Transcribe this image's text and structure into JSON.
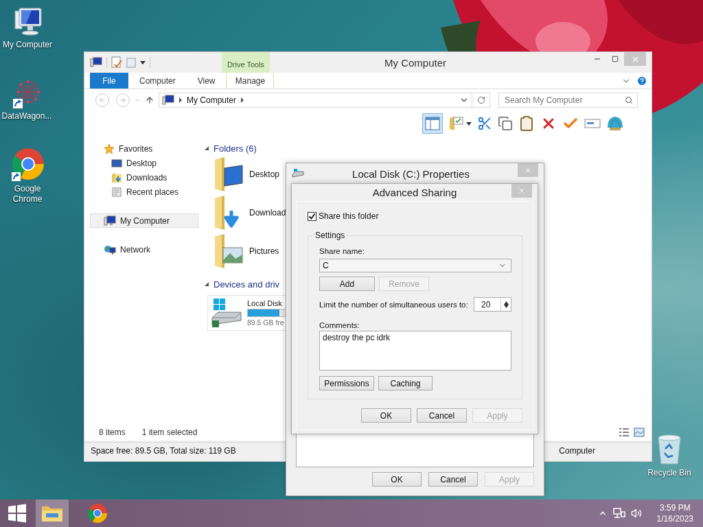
{
  "desktop_icons": [
    {
      "kind": "computer",
      "label": "My Computer"
    },
    {
      "kind": "shortcut",
      "label": "DataWagon..."
    },
    {
      "kind": "chrome",
      "label": "Google Chrome"
    },
    {
      "kind": "bin",
      "label": "Recycle Bin"
    }
  ],
  "explorer": {
    "title": "My Computer",
    "context_group": "Drive Tools",
    "ribbon_tabs": [
      {
        "kind": "file",
        "label": "File"
      },
      {
        "kind": "tab",
        "label": "Computer"
      },
      {
        "kind": "tab",
        "label": "View"
      },
      {
        "kind": "context",
        "label": "Manage"
      }
    ],
    "address": {
      "path": "My Computer"
    },
    "search": {
      "placeholder": "Search My Computer"
    },
    "preview_pane_on": true,
    "sidebar": [
      {
        "kind": "favorites",
        "label": "Favorites",
        "selected": false,
        "children": [
          {
            "kind": "desktop",
            "label": "Desktop",
            "selected": false
          },
          {
            "kind": "downloads",
            "label": "Downloads",
            "selected": false
          },
          {
            "kind": "recent",
            "label": "Recent places",
            "selected": false
          }
        ]
      },
      {
        "kind": "computer",
        "label": "My Computer",
        "selected": true
      },
      {
        "kind": "network",
        "label": "Network",
        "selected": false
      }
    ],
    "groups": [
      {
        "title": "Folders (6)",
        "expanded": true,
        "folders": [
          {
            "kind": "desktop",
            "label": "Desktop"
          },
          {
            "kind": "downloads",
            "label": "Download"
          },
          {
            "kind": "pictures",
            "label": "Pictures"
          }
        ]
      },
      {
        "title": "Devices and driv",
        "expanded": true,
        "drives": [
          {
            "label": "Local Disk",
            "level": 0.25,
            "free": "89.5 GB fre"
          }
        ]
      }
    ],
    "status": {
      "count": "8 items",
      "selection": "1 item selected"
    },
    "details": {
      "space": "Space free: 89.5 GB, Total size: 119 GB",
      "location": "Computer"
    }
  },
  "properties_dialog": {
    "title": "Local Disk (C:) Properties",
    "buttons": [
      {
        "label": "OK",
        "disabled": false
      },
      {
        "label": "Cancel",
        "disabled": false
      },
      {
        "label": "Apply",
        "disabled": true
      }
    ]
  },
  "advanced_sharing": {
    "title": "Advanced Sharing",
    "share_checkbox": {
      "label": "Share this folder",
      "checked": true
    },
    "settings_label": "Settings",
    "share_name_label": "Share name:",
    "share_name": "C",
    "share_buttons": [
      {
        "label": "Add",
        "disabled": false
      },
      {
        "label": "Remove",
        "disabled": true
      }
    ],
    "limit_label": "Limit the number of simultaneous users to:",
    "limit_value": "20",
    "comments_label": "Comments:",
    "comments": "destroy the pc idrk",
    "option_buttons": [
      {
        "label": "Permissions",
        "disabled": false
      },
      {
        "label": "Caching",
        "disabled": false
      }
    ],
    "buttons": [
      {
        "label": "OK",
        "disabled": false
      },
      {
        "label": "Cancel",
        "disabled": false
      },
      {
        "label": "Apply",
        "disabled": true
      }
    ]
  },
  "taskbar": {
    "apps": [
      {
        "kind": "explorer",
        "selected": true
      },
      {
        "kind": "chrome",
        "selected": false
      }
    ],
    "time": "3:59 PM",
    "date": "1/16/2023"
  }
}
